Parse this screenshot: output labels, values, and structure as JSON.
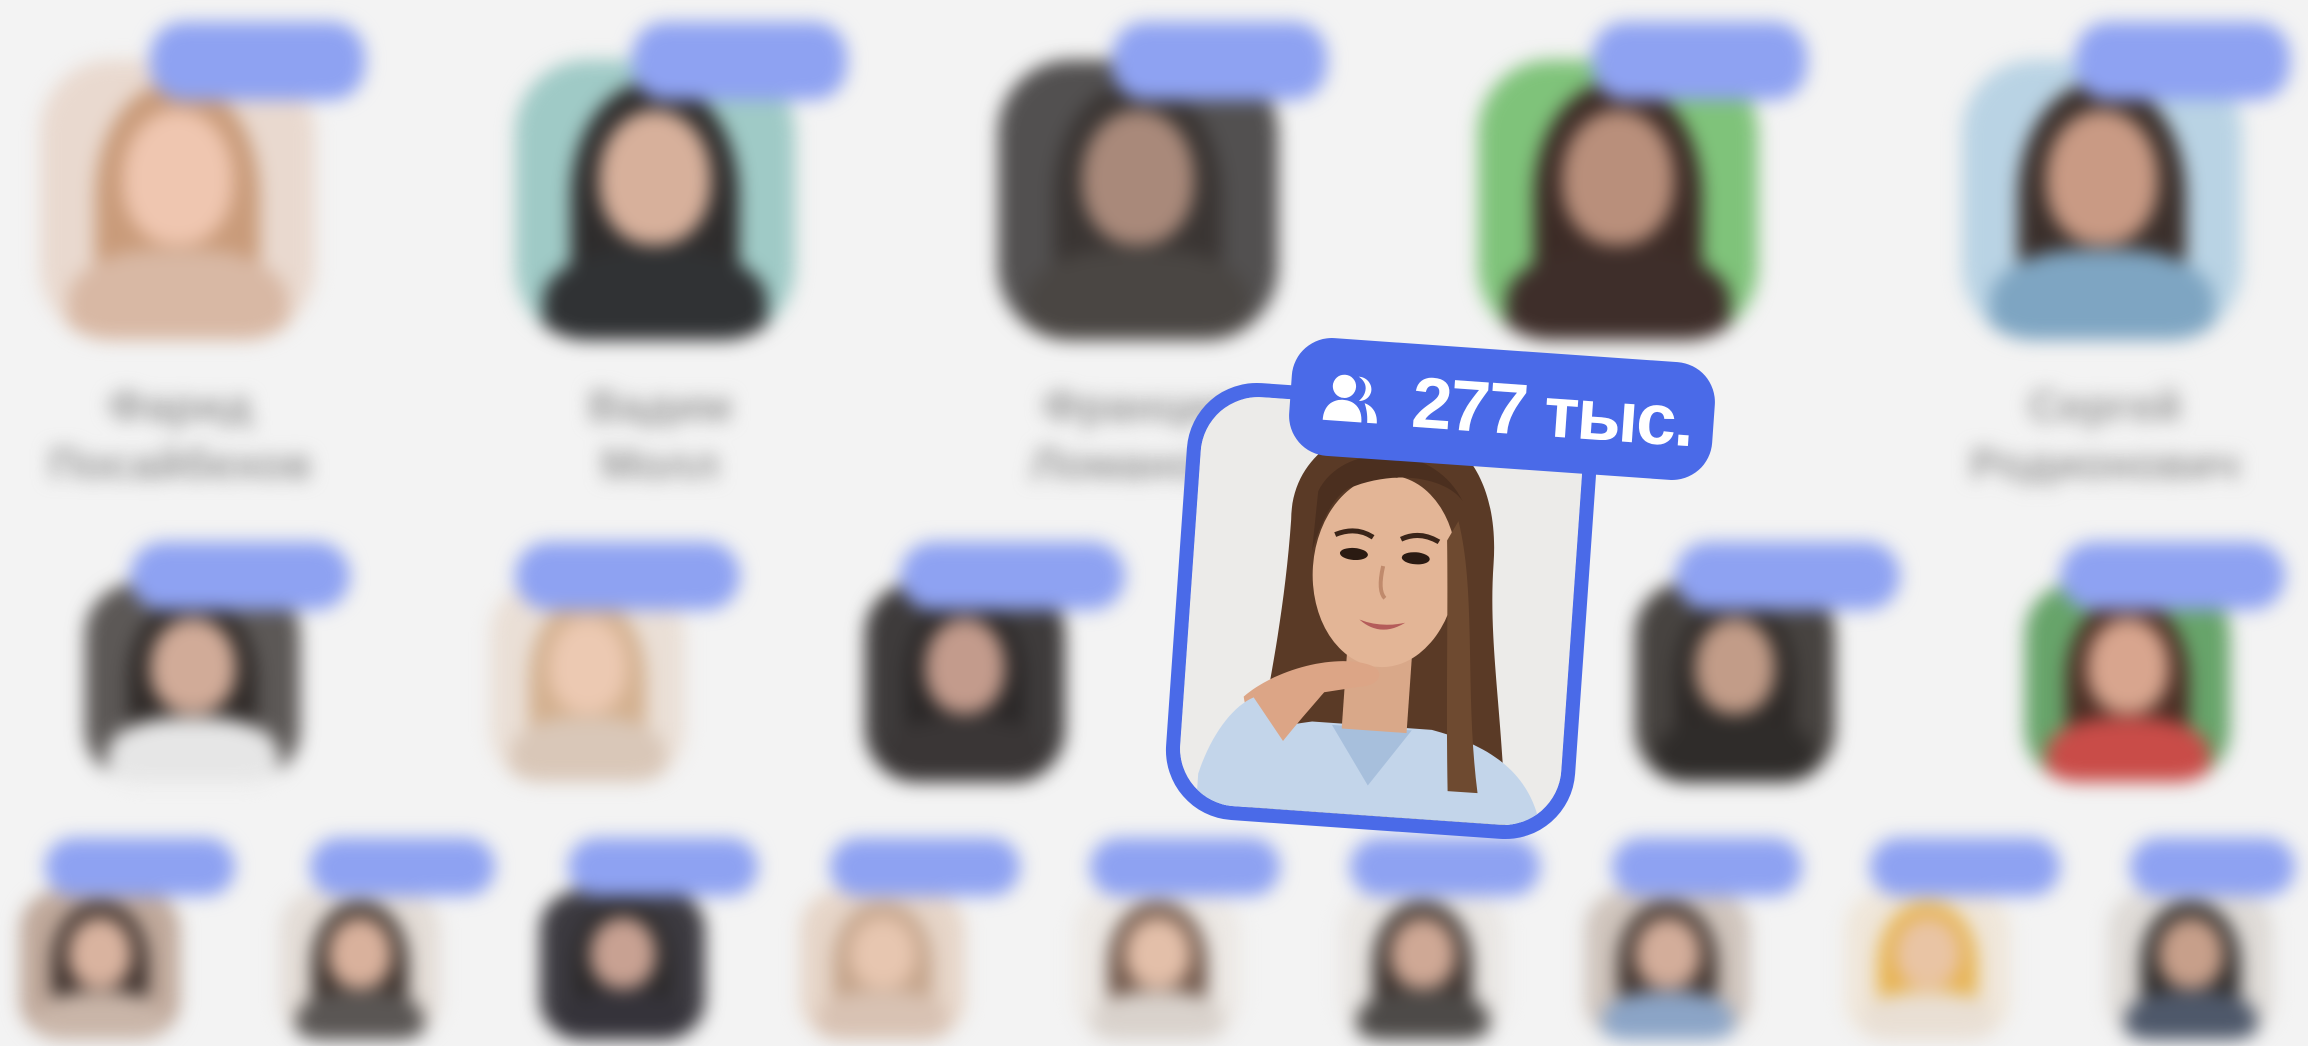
{
  "focused_profile": {
    "subscribers": "277 тыс.",
    "icon": "users-icon",
    "accent_color": "#4a6ae8"
  },
  "background_profiles": {
    "row1_names": [
      "Фарид\nПосайбехов",
      "Вадим\nМолл",
      "Франция\nЛоманова",
      "",
      "Сергей\nРодионович"
    ]
  },
  "colors": {
    "accent": "#4a6ae8",
    "pill_blurred": "#8ea2f2",
    "background": "#f3f3f3"
  }
}
